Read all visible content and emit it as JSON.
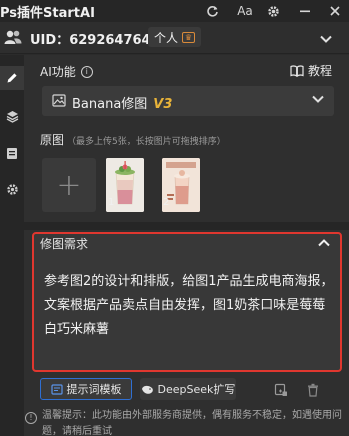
{
  "app": {
    "title": "Ps插件StartAI"
  },
  "titlebar": {
    "font_button": "Aa"
  },
  "account": {
    "uid_label": "UID：",
    "uid_value": "629264764",
    "plan_label": "个人",
    "plan_badge": "☐"
  },
  "ai_section": {
    "label": "AI功能",
    "tutorial_label": "教程",
    "selected_function": "Banana修图",
    "selected_version": "V3"
  },
  "original_images": {
    "label": "原图",
    "hint": "（最多上传5张，长按图片可拖拽排序）",
    "add_glyph": "+",
    "items": [
      {
        "index": "1"
      },
      {
        "index": "2"
      }
    ]
  },
  "edit_request": {
    "label": "修图需求",
    "text": "参考图2的设计和排版，给图1产品生成电商海报，文案根据产品卖点自由发挥，图1奶茶口味是莓莓白巧米麻薯"
  },
  "actions": {
    "template_button": "提示词模板",
    "deepseek_button": "DeepSeek扩写"
  },
  "notice": {
    "text": "温馨提示：此功能由外部服务商提供，偶有服务不稳定，如遇使用问题，请稍后重试"
  },
  "colors": {
    "accent_blue": "#2f6fd3",
    "highlight_red": "#e0372f",
    "version_gold": "#e8b339"
  }
}
